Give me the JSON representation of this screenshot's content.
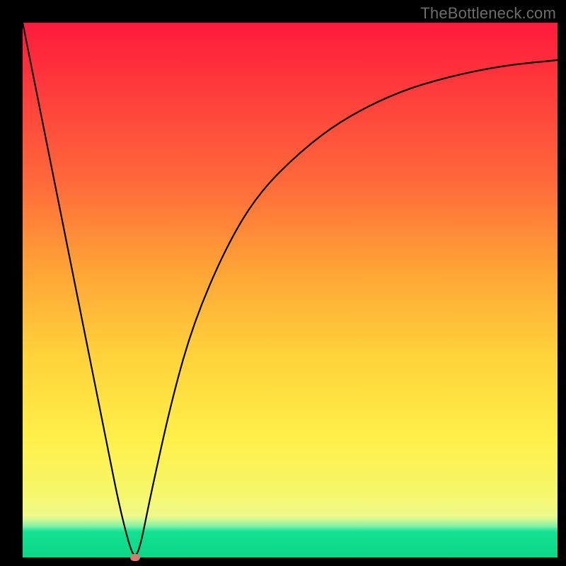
{
  "watermark": "TheBottleneck.com",
  "chart_data": {
    "type": "line",
    "title": "",
    "xlabel": "",
    "ylabel": "",
    "xlim": [
      0,
      100
    ],
    "ylim": [
      0,
      100
    ],
    "x": [
      0,
      4,
      8,
      12,
      16,
      18,
      20,
      21,
      22,
      24,
      28,
      32,
      38,
      44,
      52,
      60,
      70,
      80,
      90,
      100
    ],
    "values": [
      100,
      80,
      60,
      40,
      20,
      10,
      2,
      0,
      2,
      12,
      30,
      44,
      58,
      68,
      76,
      82,
      87,
      90,
      92,
      93
    ],
    "annotations": [
      {
        "name": "minimum-marker",
        "x": 21,
        "y": 0
      }
    ],
    "grid": false,
    "legend": false
  },
  "colors": {
    "gradient_top": "#ff1a3c",
    "gradient_mid1": "#ffa336",
    "gradient_mid2": "#fff04a",
    "gradient_bottom": "#0cd786",
    "curve": "#000000",
    "marker": "#d77b72",
    "frame": "#000000",
    "watermark": "#6d6d6d"
  }
}
